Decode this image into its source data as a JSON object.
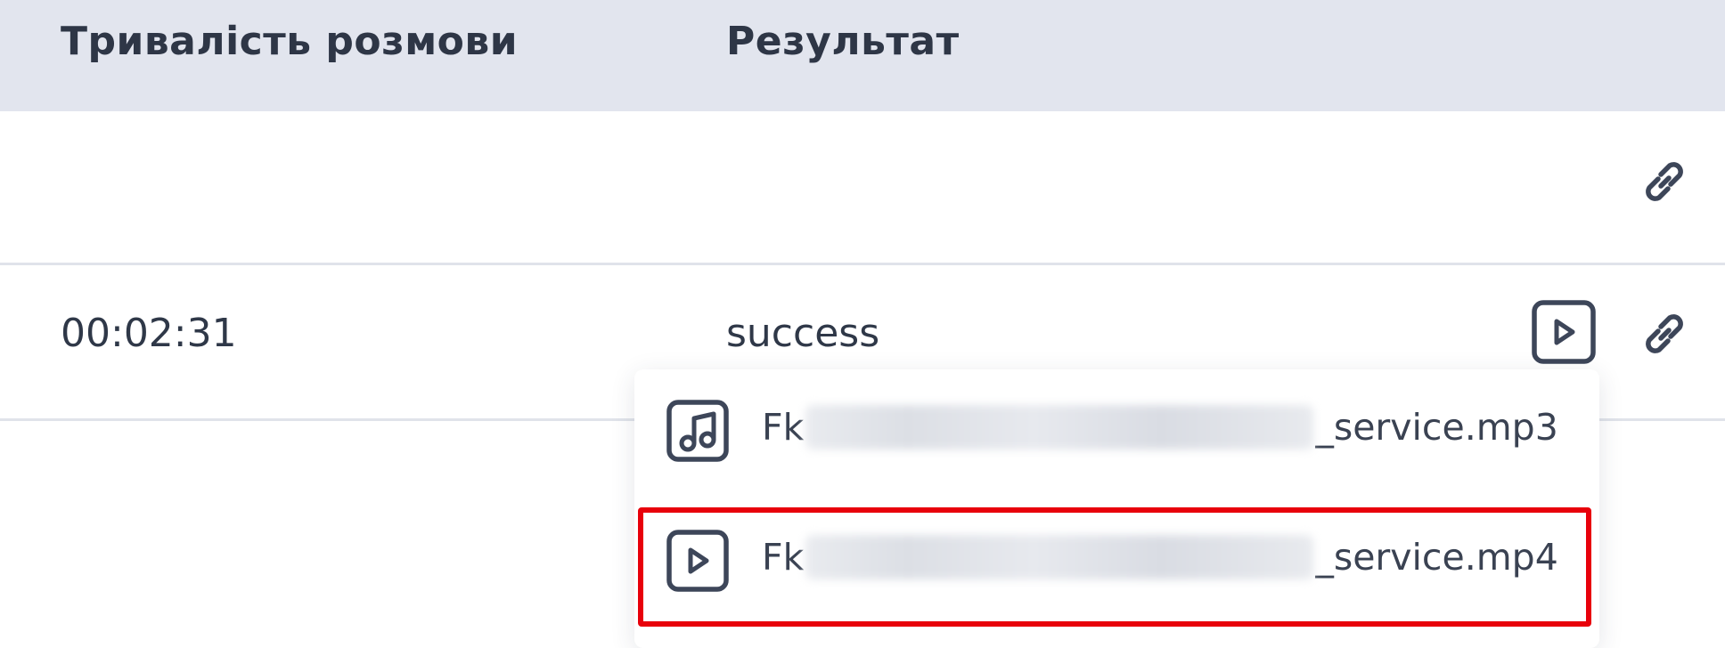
{
  "table": {
    "columns": {
      "duration": "Тривалість розмови",
      "result": "Результат"
    },
    "rows": [
      {
        "duration": "",
        "result": "",
        "icons": [
          "link-icon"
        ]
      },
      {
        "duration": "00:02:31",
        "result": "success",
        "icons": [
          "play-icon",
          "link-icon"
        ]
      }
    ]
  },
  "dropdown": {
    "items": [
      {
        "icon": "audio-file-icon",
        "prefix": "Fk",
        "suffix": "_service.mp3"
      },
      {
        "icon": "video-file-icon",
        "prefix": "Fk",
        "suffix": "_service.mp4",
        "highlighted": true
      }
    ]
  },
  "colors": {
    "header_bg": "#e2e5ee",
    "icon_stroke": "#3d4659",
    "highlight_border": "#e8000b",
    "divider": "#e0e3ea"
  }
}
